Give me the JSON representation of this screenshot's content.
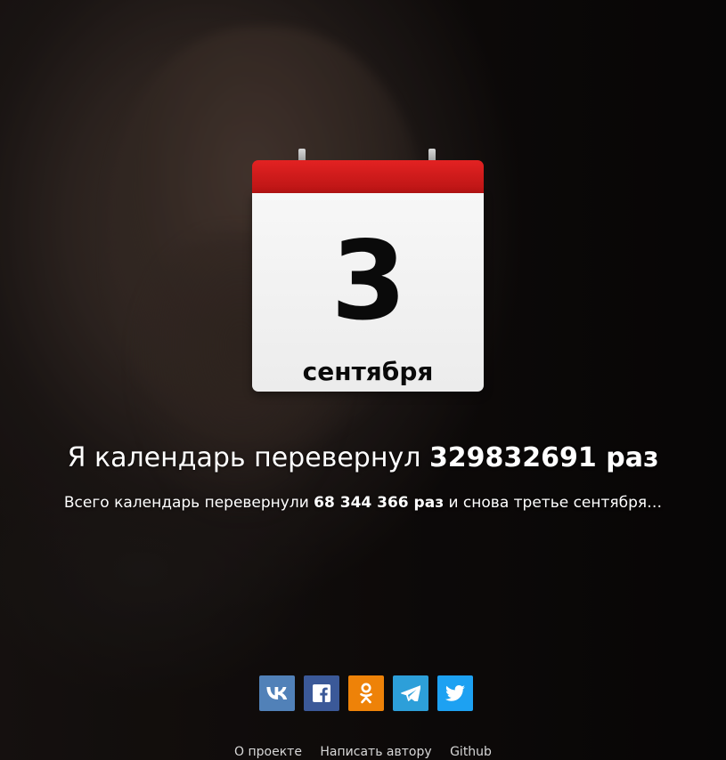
{
  "calendar": {
    "day": "3",
    "month": "сентября"
  },
  "headline": {
    "prefix": "Я календарь перевернул ",
    "count": "329832691",
    "suffix": " раз"
  },
  "subline": {
    "prefix": "Всего календарь перевернули ",
    "count": "68 344 366 раз",
    "suffix": " и снова третье сентября…"
  },
  "share": [
    {
      "name": "vk",
      "icon": "vk-icon",
      "color": "#5181b8"
    },
    {
      "name": "facebook",
      "icon": "facebook-icon",
      "color": "#3b5998"
    },
    {
      "name": "odnoklassniki",
      "icon": "odnoklassniki-icon",
      "color": "#ee8208"
    },
    {
      "name": "telegram",
      "icon": "telegram-icon",
      "color": "#2d9fd9"
    },
    {
      "name": "twitter",
      "icon": "twitter-icon",
      "color": "#1da1f2"
    }
  ],
  "footer": {
    "about": "О проекте",
    "write_author": "Написать автору",
    "github": "Github"
  },
  "colors": {
    "calendar_header": "#d91c1c",
    "text": "#ffffff",
    "footer_text": "#d7d7d7"
  }
}
